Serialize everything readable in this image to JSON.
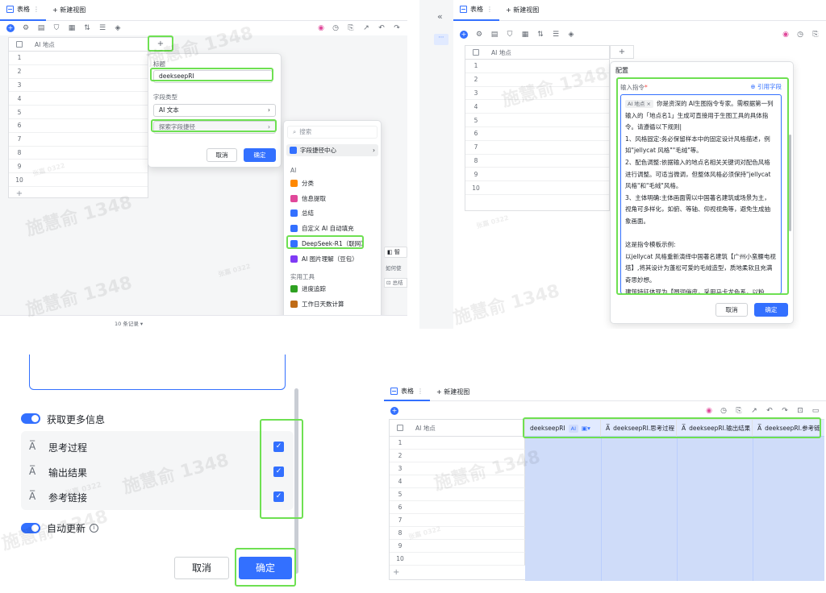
{
  "p1": {
    "tabs": {
      "table": "表格",
      "new_view": "+ 新建视图"
    },
    "header": {
      "field": "AI 地点"
    },
    "rows": [
      "1",
      "2",
      "3",
      "4",
      "5",
      "6",
      "7",
      "8",
      "9",
      "10"
    ],
    "add_row": "+",
    "add_col": "+",
    "config": {
      "title_label": "标题",
      "title_value": "deekseepRI",
      "type_label": "字段类型",
      "type_value": "AI 文本",
      "search_shortcut": "探索字段捷径",
      "cancel": "取消",
      "confirm": "确定"
    },
    "menu": {
      "search_placeholder": "搜索",
      "shortcut_center": "字段捷径中心",
      "section_ai": "AI",
      "items_ai": [
        "分类",
        "信息提取",
        "总结",
        "自定义 AI 自动填充",
        "DeepSeek-R1（联网）",
        "AI 图片理解（豆包）"
      ],
      "section_tools": "实用工具",
      "items_tools": [
        "进度追踪",
        "工作日天数计算",
        "标记重复值"
      ]
    },
    "side_fragments": [
      "如何使",
      "总结"
    ],
    "records": "10 条记录",
    "watermarks": [
      "施慧俞 1348",
      "施慧俞 1348",
      "施慧俞 1348",
      "张嘉 0322",
      "张嘉 0322"
    ]
  },
  "p2": {
    "tabs": {
      "table": "表格",
      "new_view": "+ 新建视图"
    },
    "header": {
      "field": "AI 地点"
    },
    "rows": [
      "1",
      "2",
      "3",
      "4",
      "5",
      "6",
      "7",
      "8",
      "9",
      "10"
    ],
    "add_col": "+",
    "config": {
      "heading": "配置",
      "prompt_label": "输入指令",
      "ref_field": "引用字段",
      "tag": "AI 地点 ×",
      "prompt_lines": [
        "你是资深的 AI生图指令专家。需根据第一列",
        "输入的「地点名1」生成可直接用于生图工具的具体指",
        "令。请遵循以下规则|",
        "1、风格固定:务必保留样本中的固定设计风格描述，例",
        "如\"jellycat 风格\"\"毛绒\"等。",
        "2、配色调整:依据输入的地点名相关关键词对配色风格",
        "进行调整。可适当微调，但整体风格必须保持\"jellycat",
        "风格\"和\"毛绒\"风格。",
        "3、主体明确:主体画面需以中国著名建筑或场景为主，",
        "视角可多样化，如俯、等轴、仰视视角等，避免生成抽",
        "象画面。",
        "",
        "这是指令模板示例:",
        "以jellycat 风格重新演绎中国著名建筑【广州小蛮腰电视",
        "塔】,将其设计为蓬松可爱的毛绒造型，质地柔软且充满",
        "奇思妙想。",
        "建筑特征体现为【圆润俏皮，采用马卡龙色系，以粉"
      ],
      "cancel": "取消",
      "confirm": "确定"
    },
    "collapse": "«",
    "watermarks": [
      "施慧俞 1348",
      "施慧俞 1348",
      "张嘉 0322"
    ]
  },
  "p3": {
    "more_info": "获取更多信息",
    "options": [
      "思考过程",
      "输出结果",
      "参考链接"
    ],
    "auto_update": "自动更新",
    "cancel": "取消",
    "confirm": "确定",
    "watermarks": [
      "施慧俞 1348",
      "施慧俞 1348",
      "张嘉 0322"
    ]
  },
  "p4": {
    "tabs": {
      "table": "表格",
      "new_view": "+ 新建视图"
    },
    "header": {
      "field": "AI 地点"
    },
    "rows": [
      "1",
      "2",
      "3",
      "4",
      "5",
      "6",
      "7",
      "8",
      "9",
      "10"
    ],
    "cols": [
      "deekseepRI",
      "deekseepRI.思考过程",
      "deekseepRI.输出结果",
      "deekseepRI.参考链"
    ],
    "ai_badge": "AI",
    "add_row": "+",
    "watermarks": [
      "施慧俞 1348",
      "张嘉 0322"
    ]
  },
  "colors": {
    "accent": "#3370ff",
    "highlight": "#6ee052"
  }
}
